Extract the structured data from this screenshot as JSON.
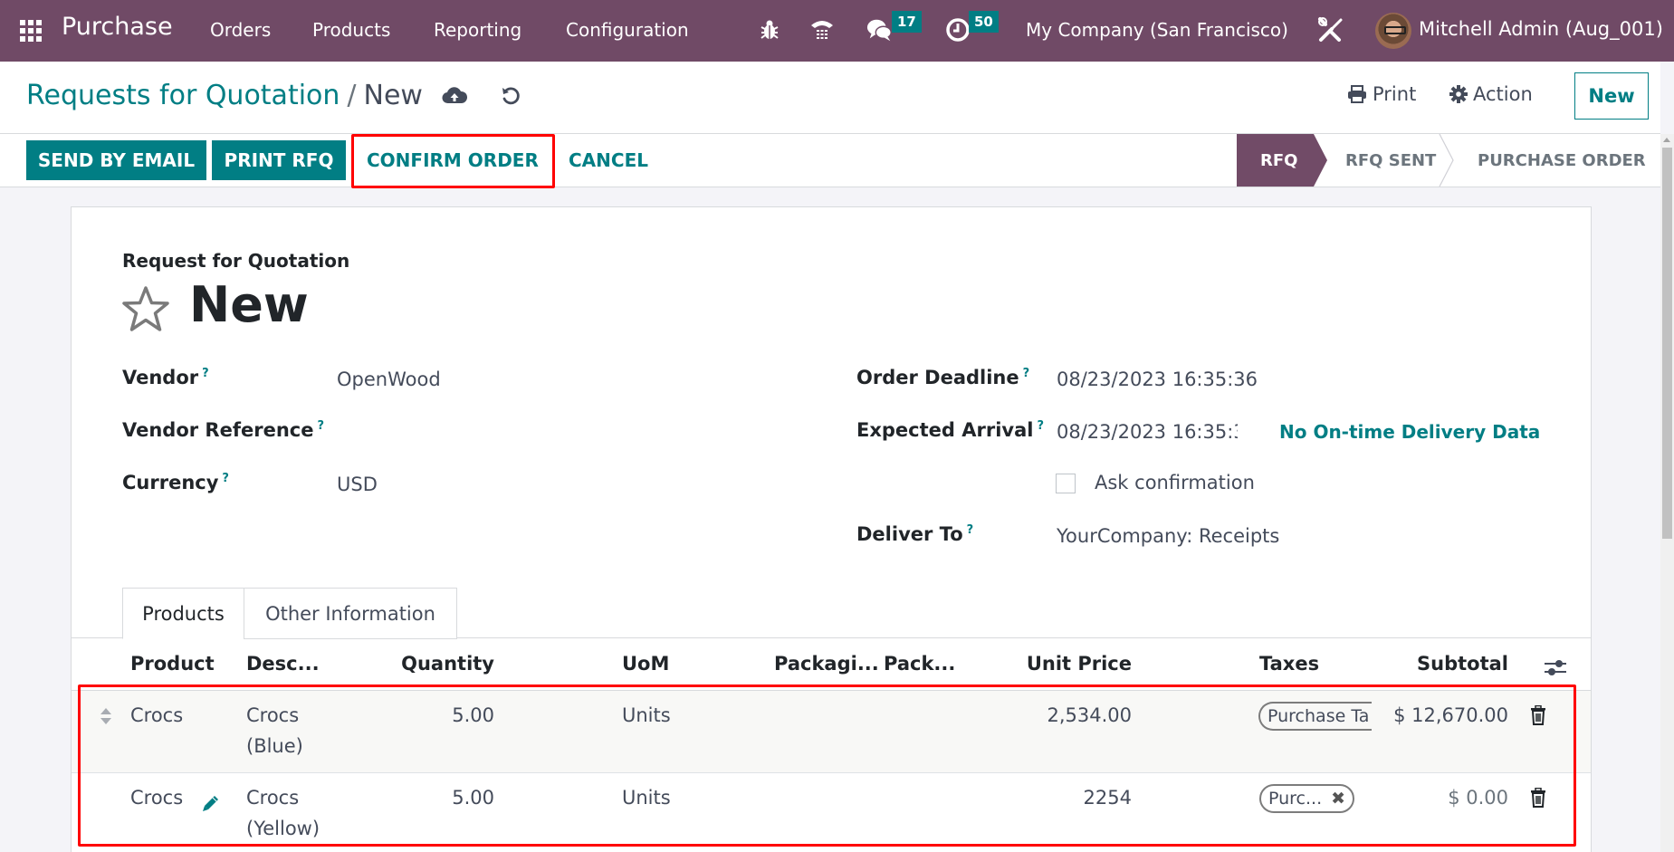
{
  "navbar": {
    "app_name": "Purchase",
    "menu": [
      "Orders",
      "Products",
      "Reporting",
      "Configuration"
    ],
    "icons": [
      "debug-icon",
      "phone-icon",
      "messages-icon",
      "activity-clock-icon",
      "settings-tools-icon"
    ],
    "messages_count": "17",
    "activities_count": "50",
    "company": "My Company (San Francisco)",
    "user": "Mitchell Admin (Aug_001)"
  },
  "breadcrumb": {
    "parent": "Requests for Quotation",
    "separator": "/",
    "current": "New"
  },
  "control_panel": {
    "print_label": "Print",
    "action_label": "Action",
    "new_label": "New"
  },
  "actions": {
    "send_by_email": "SEND BY EMAIL",
    "print_rfq": "PRINT RFQ",
    "confirm_order": "CONFIRM ORDER",
    "cancel": "CANCEL"
  },
  "status": {
    "steps": [
      "RFQ",
      "RFQ SENT",
      "PURCHASE ORDER"
    ],
    "active": "RFQ"
  },
  "form": {
    "doc_type": "Request for Quotation",
    "name": "New",
    "help_marker": "?",
    "fields_left": [
      {
        "label": "Vendor",
        "value": "OpenWood"
      },
      {
        "label": "Vendor Reference",
        "value": ""
      },
      {
        "label": "Currency",
        "value": "USD"
      }
    ],
    "fields_right": [
      {
        "label": "Order Deadline",
        "value": "08/23/2023 16:35:36"
      },
      {
        "label": "Expected Arrival",
        "value": "08/23/2023 16:35:3"
      },
      {
        "label": "Deliver To",
        "value": "YourCompany: Receipts"
      }
    ],
    "on_time_delivery": "No On-time Delivery Data",
    "ask_confirmation_label": "Ask confirmation",
    "ask_confirmation_checked": false
  },
  "tabs": [
    {
      "label": "Products",
      "active": true
    },
    {
      "label": "Other Information",
      "active": false
    }
  ],
  "order_lines": {
    "columns": [
      "Product",
      "Desc...",
      "Quantity",
      "UoM",
      "Packagi...",
      "Pack...",
      "Unit Price",
      "Taxes",
      "Subtotal"
    ],
    "rows": [
      {
        "product": "Crocs",
        "description_line1": "Crocs",
        "description_line2": "(Blue)",
        "quantity": "5.00",
        "uom": "Units",
        "packaging_qty": "",
        "packaging": "",
        "unit_price": "2,534.00",
        "taxes": "Purchase Ta",
        "subtotal": "$ 12,670.00"
      },
      {
        "product": "Crocs",
        "description_line1": "Crocs",
        "description_line2": "(Yellow)",
        "quantity": "5.00",
        "uom": "Units",
        "packaging_qty": "",
        "packaging": "",
        "unit_price": "2254",
        "taxes": "Purc...",
        "subtotal": "$ 0.00"
      }
    ]
  },
  "colors": {
    "brand": "#714b67",
    "accent": "#017e84",
    "highlight": "#ff0000"
  }
}
